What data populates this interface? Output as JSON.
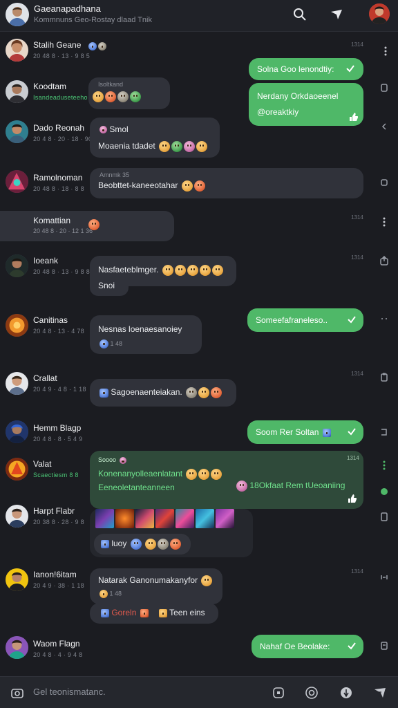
{
  "header": {
    "title": "Gaeanapadhana",
    "subtitle": "Kommnuns Geo-Rostay dlaad Tnik"
  },
  "composer": {
    "placeholder": "Gel teonismatanc."
  },
  "rows": [
    {
      "name": "Stalih Geane",
      "meta": "20 48 8 · 13 · 9 8 5",
      "time": "1314"
    },
    {
      "name": "Koodtam",
      "meta": "Isandeaduseteeho",
      "time": ""
    },
    {
      "name": "Dado Reonah",
      "meta": "20 4 8 · 20 · 18 · 90",
      "time": ""
    },
    {
      "name": "Ramolnoman",
      "meta": "20 48 8 · 18 · 8 8",
      "time": ""
    },
    {
      "name": "Komattian",
      "meta": "20 48 8 · 20 · 12 1 36",
      "time": "1314"
    },
    {
      "name": "Ioeank",
      "meta": "20 48 8 · 13 · 9 8 8",
      "time": "1314"
    },
    {
      "name": "Canitinas",
      "meta": "20 4 8 · 13 · 4 78",
      "time": ""
    },
    {
      "name": "Crallat",
      "meta": "20 4 9 · 4 8 · 1 18",
      "time": "1314"
    },
    {
      "name": "Hemm Blagp",
      "meta": "20 4 8 · 8 · 5 4 9",
      "time": ""
    },
    {
      "name": "Valat",
      "meta": "Scaectiesm 8 8",
      "time": ""
    },
    {
      "name": "Harpt Flabr",
      "meta": "20 38 8 · 28 · 9 8",
      "time": ""
    },
    {
      "name": "Ianon!6itam",
      "meta": "20 4 9 · 38 · 1 18",
      "time": "1314"
    },
    {
      "name": "Waom Flagn",
      "meta": "20 4 8 · 4 · 9 4 8",
      "time": ""
    }
  ],
  "bubbles": {
    "out1": "Solna Goo lenondtiy:",
    "out2a": "Nerdany Orkdaoeenel",
    "out2b": "@oreaktkiy",
    "b2_top": "Isoltkand",
    "b3a": "Smol",
    "b3b": "Moaenia tdadet",
    "b4_top": "Amnmk 35",
    "b4": "Beobttet-kaneeotahar",
    "b6a": "Nasfaeteblmger.",
    "b6b": "Snoi",
    "b7a": "Nesnas loenaesanoiey",
    "b7b": "1 48",
    "out3": "Someefafraneleso..",
    "b8": "Sagoenaenteiakan.",
    "out4": "Soom Rer Soltan",
    "b10_top": "Soooo",
    "b10a": "Konenanyolleaenlatant",
    "b10b": "Eeneoletanteanneen",
    "b10c": "18Okfaat Rem tUeoaniing",
    "b11": "luoy",
    "b12a": "Natarak Ganonumakanyfor",
    "b12b": "1 48",
    "b12c": "Goreln",
    "b12d": "Teen eins",
    "out5": "Nahaf Oe Beolake:"
  },
  "colors": {
    "background": "#1b1c21",
    "bubble": "#30323a",
    "accent_green": "#4fb868"
  }
}
